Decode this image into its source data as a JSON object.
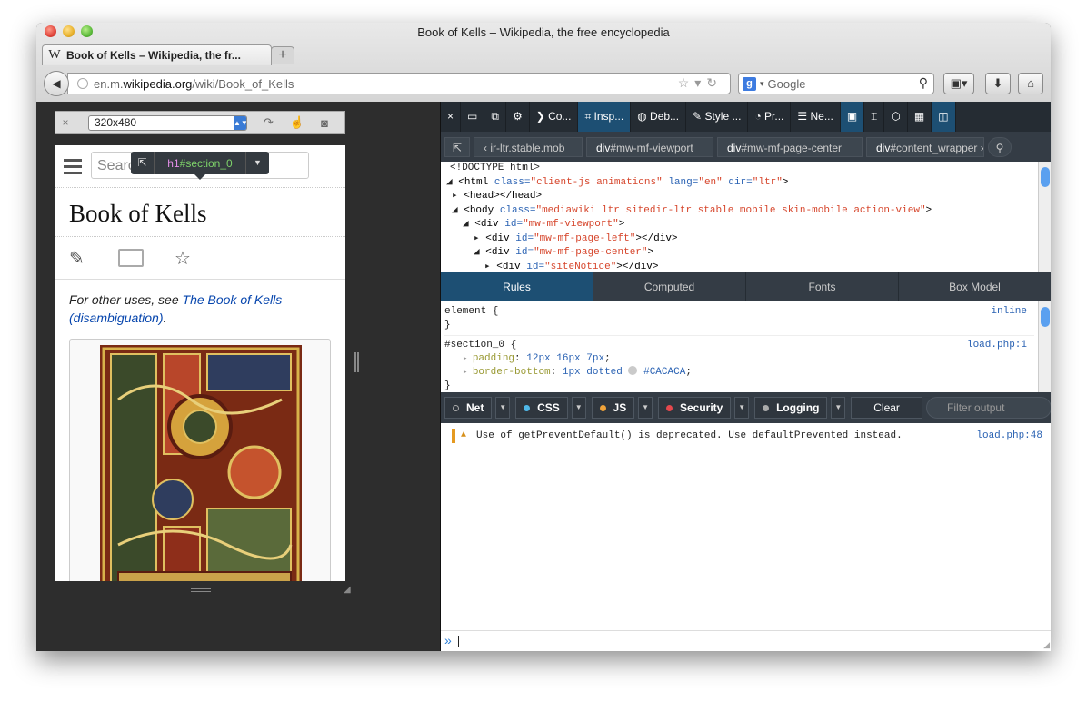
{
  "window": {
    "title": "Book of Kells – Wikipedia, the free encyclopedia"
  },
  "tab": {
    "logo": "W",
    "title": "Book of Kells – Wikipedia, the fr...",
    "new_tab_label": "+"
  },
  "nav": {
    "url_prefix": "en.m.",
    "url_domain": "wikipedia.org",
    "url_path": "/wiki/Book_of_Kells",
    "search_placeholder": "Google",
    "search_engine_letter": "g"
  },
  "responsive": {
    "size": "320x480"
  },
  "mobile": {
    "search_placeholder": "Search",
    "title": "Book of Kells",
    "hatnote_prefix": "For other uses, see ",
    "hatnote_link": "The Book of Kells (disambiguation)",
    "hatnote_suffix": "."
  },
  "infobar": {
    "tag": "h1",
    "id": "#section_0"
  },
  "devtools": {
    "tools": [
      {
        "label": "Co..."
      },
      {
        "label": "Insp..."
      },
      {
        "label": "Deb..."
      },
      {
        "label": "Style ..."
      },
      {
        "label": "Pr..."
      },
      {
        "label": "Ne..."
      }
    ],
    "breadcrumbs": [
      {
        "tag": "",
        "rest": "ir-ltr.stable.mob"
      },
      {
        "tag": "div",
        "rest": "#mw-mf-viewport"
      },
      {
        "tag": "div",
        "rest": "#mw-mf-page-center"
      },
      {
        "tag": "div",
        "rest": "#content_wrapper"
      }
    ],
    "markup": {
      "doctype": "<!DOCTYPE html>",
      "html_class": "client-js animations",
      "html_lang": "en",
      "html_dir": "ltr",
      "head": "<head></head>",
      "body_class": "mediawiki ltr sitedir-ltr stable mobile skin-mobile action-view",
      "viewport_id": "mw-mf-viewport",
      "left_id": "mw-mf-page-left",
      "center_id": "mw-mf-page-center",
      "notice_id": "siteNotice"
    },
    "subtabs": [
      "Rules",
      "Computed",
      "Fonts",
      "Box Model"
    ],
    "rules": {
      "element_selector": "element {",
      "element_close": "}",
      "element_source": "inline",
      "section_selector": "#section_0 {",
      "section_source": "load.php:1",
      "padding_name": "padding",
      "padding_value": "12px 16px 7px",
      "border_name": "border-bottom",
      "border_value": "1px dotted",
      "border_color": "#CACACA",
      "section_close": "}"
    },
    "console": {
      "filters": [
        {
          "label": "Net",
          "color": "#2b2b2b"
        },
        {
          "label": "CSS",
          "color": "#4fb8e8"
        },
        {
          "label": "JS",
          "color": "#f0a33a"
        },
        {
          "label": "Security",
          "color": "#e5484d"
        },
        {
          "label": "Logging",
          "color": "#aaaaaa"
        }
      ],
      "clear_label": "Clear",
      "filter_placeholder": "Filter output",
      "message": "Use of getPreventDefault() is deprecated.  Use defaultPrevented instead.",
      "message_source": "load.php:48",
      "prompt": "»"
    }
  }
}
